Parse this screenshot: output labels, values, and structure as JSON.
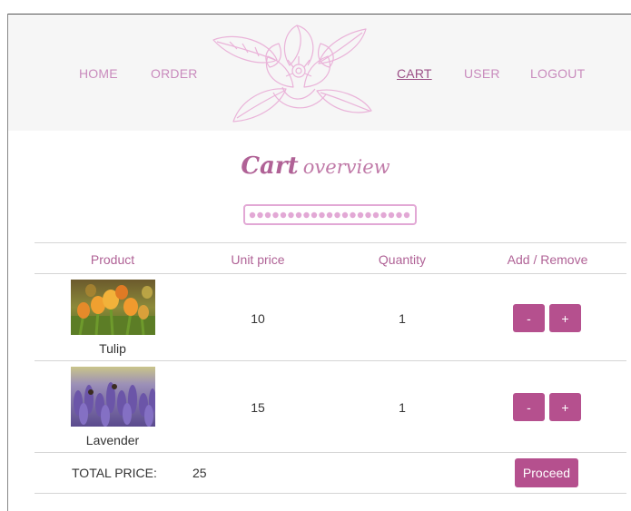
{
  "nav": {
    "home": "HOME",
    "order": "ORDER",
    "cart": "CART",
    "user": "USER",
    "logout": "LOGOUT"
  },
  "title": {
    "main": "Cart",
    "sub": "overview"
  },
  "table": {
    "headers": [
      "Product",
      "Unit price",
      "Quantity",
      "Add / Remove"
    ],
    "rows": [
      {
        "product": "Tulip",
        "unit_price": "10",
        "quantity": "1",
        "minus": "-",
        "plus": "+"
      },
      {
        "product": "Lavender",
        "unit_price": "15",
        "quantity": "1",
        "minus": "-",
        "plus": "+"
      }
    ],
    "total_label": "TOTAL PRICE:",
    "total_value": "25",
    "proceed_label": "Proceed"
  },
  "colors": {
    "accent": "#b5508e",
    "nav_text": "#c98bbd",
    "header_bg": "#f6f6f6"
  },
  "icons": {
    "logo": "magnolia-flower-logo",
    "divider": "beaded-divider"
  }
}
